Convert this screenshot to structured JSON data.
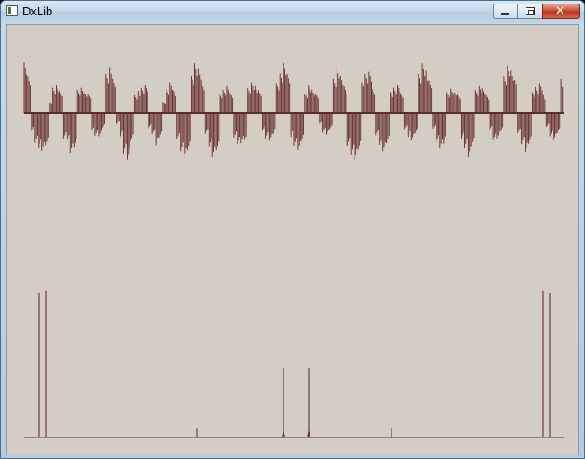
{
  "window": {
    "title": "DxLib",
    "icon": "app-window-icon",
    "buttons": [
      {
        "name": "minimize",
        "icon": "minimize-icon"
      },
      {
        "name": "maximize",
        "icon": "maximize-icon"
      },
      {
        "name": "close",
        "icon": "close-icon",
        "glyph": "✕"
      }
    ]
  },
  "colors": {
    "background": "#d4cdc4",
    "waveform": "#6e3838",
    "baseline": "#5a2e2e"
  },
  "waveform": {
    "sample_count": 150,
    "amplitudes": [
      0.98,
      0.7,
      -0.34,
      -0.56,
      -0.66,
      -0.72,
      -0.61,
      0.23,
      0.49,
      0.53,
      0.43,
      -0.48,
      -0.55,
      -0.76,
      -0.64,
      0.45,
      0.49,
      0.42,
      0.38,
      -0.31,
      -0.43,
      -0.44,
      -0.27,
      0.76,
      0.87,
      0.66,
      -0.2,
      -0.44,
      -0.77,
      -0.89,
      -0.53,
      0.35,
      0.43,
      0.49,
      0.55,
      -0.28,
      -0.4,
      -0.61,
      -0.46,
      0.22,
      0.46,
      0.59,
      0.43,
      -0.5,
      -0.73,
      -0.87,
      -0.71,
      0.73,
      0.96,
      0.85,
      0.58,
      -0.39,
      -0.63,
      -0.84,
      -0.71,
      0.38,
      0.45,
      0.52,
      0.39,
      -0.46,
      -0.59,
      -0.57,
      -0.51,
      0.48,
      0.59,
      0.52,
      0.44,
      -0.33,
      -0.48,
      -0.52,
      -0.39,
      0.58,
      0.77,
      0.97,
      0.76,
      -0.45,
      -0.62,
      -0.7,
      -0.54,
      0.38,
      0.53,
      0.45,
      0.38,
      -0.22,
      -0.37,
      -0.41,
      -0.3,
      0.66,
      0.88,
      0.72,
      0.51,
      -0.62,
      -0.79,
      -0.9,
      -0.7,
      0.59,
      0.76,
      0.8,
      0.46,
      -0.42,
      -0.6,
      -0.73,
      -0.57,
      0.41,
      0.49,
      0.55,
      0.39,
      -0.3,
      -0.45,
      -0.52,
      -0.38,
      0.76,
      0.96,
      0.82,
      0.63,
      -0.29,
      -0.55,
      -0.66,
      -0.58,
      0.4,
      0.47,
      0.45,
      0.36,
      -0.48,
      -0.66,
      -0.83,
      -0.62,
      0.45,
      0.52,
      0.48,
      0.35,
      -0.32,
      -0.51,
      -0.48,
      -0.35,
      0.7,
      0.92,
      0.82,
      0.64,
      -0.38,
      -0.59,
      -0.74,
      -0.58,
      0.4,
      0.5,
      0.58,
      0.35,
      -0.26,
      -0.44,
      -0.52,
      -0.38,
      0.66
    ]
  },
  "spectrum": {
    "bin_count": 150,
    "peaks": [
      {
        "bin": 4,
        "level": 1.0
      },
      {
        "bin": 6,
        "level": 1.02
      },
      {
        "bin": 48,
        "level": 0.06
      },
      {
        "bin": 72,
        "level": 0.48
      },
      {
        "bin": 79,
        "level": 0.48
      },
      {
        "bin": 102,
        "level": 0.06
      },
      {
        "bin": 144,
        "level": 1.02
      },
      {
        "bin": 146,
        "level": 1.0
      }
    ]
  }
}
